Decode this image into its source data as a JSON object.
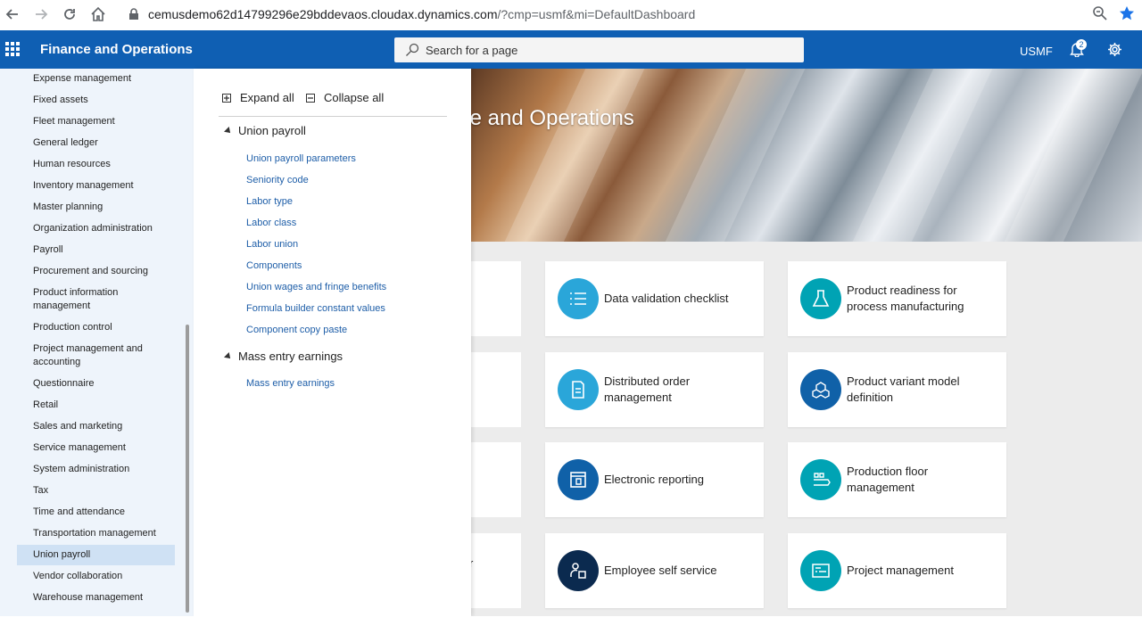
{
  "browser": {
    "url_host": "cemusdemo62d14799296e29bddevaos.cloudax.dynamics.com",
    "url_path": "/?cmp=usmf&mi=DefaultDashboard"
  },
  "header": {
    "app_title": "Finance and Operations",
    "search_placeholder": "Search for a page",
    "company": "USMF",
    "notification_count": "2"
  },
  "hero": {
    "title_partial": "te and Operations"
  },
  "tiles": [
    {
      "label": "Data validation checklist",
      "color": "#2aa6d9"
    },
    {
      "label": "Product readiness for process manufacturing",
      "color": "#00a3b4"
    },
    {
      "label": "Distributed order management",
      "color": "#2aa6d9"
    },
    {
      "label": "Product variant model definition",
      "color": "#1061a8"
    },
    {
      "label": "Electronic reporting",
      "color": "#1061a8"
    },
    {
      "label": "Production floor management",
      "color": "#00a3b4"
    },
    {
      "label": "Employee self service",
      "color": "#0b2a4f"
    },
    {
      "label": "Project management",
      "color": "#00a3b4"
    }
  ],
  "partial_tile_char": "r",
  "sidebar": {
    "items": [
      {
        "label": "Expense management"
      },
      {
        "label": "Fixed assets"
      },
      {
        "label": "Fleet management"
      },
      {
        "label": "General ledger"
      },
      {
        "label": "Human resources"
      },
      {
        "label": "Inventory management"
      },
      {
        "label": "Master planning"
      },
      {
        "label": "Organization administration"
      },
      {
        "label": "Payroll"
      },
      {
        "label": "Procurement and sourcing"
      },
      {
        "label": "Product information management"
      },
      {
        "label": "Production control"
      },
      {
        "label": "Project management and accounting"
      },
      {
        "label": "Questionnaire"
      },
      {
        "label": "Retail"
      },
      {
        "label": "Sales and marketing"
      },
      {
        "label": "Service management"
      },
      {
        "label": "System administration"
      },
      {
        "label": "Tax"
      },
      {
        "label": "Time and attendance"
      },
      {
        "label": "Transportation management"
      },
      {
        "label": "Union payroll"
      },
      {
        "label": "Vendor collaboration"
      },
      {
        "label": "Warehouse management"
      }
    ],
    "active": "Union payroll"
  },
  "flyout": {
    "expand_all": "Expand all",
    "collapse_all": "Collapse all",
    "groups": [
      {
        "title": "Union payroll",
        "links": [
          "Union payroll parameters",
          "Seniority code",
          "Labor type",
          "Labor class",
          "Labor union",
          "Components",
          "Union wages and fringe benefits",
          "Formula builder constant values",
          "Component copy paste"
        ]
      },
      {
        "title": "Mass entry earnings",
        "links": [
          "Mass entry earnings"
        ]
      }
    ]
  }
}
